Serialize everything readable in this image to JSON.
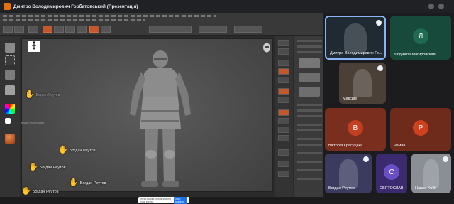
{
  "window": {
    "title": "Дмитро Володимирович Горбатовський (Презентація)"
  },
  "zbrush": {
    "raised_hands": [
      {
        "name": "Богдан Реутов"
      },
      {
        "name": "Богдан Реутов"
      },
      {
        "name": "Богдан Реутов"
      },
      {
        "name": "Богдан Реутов"
      }
    ],
    "ghost_name": "Богдан Реутов",
    "brush_tooltip": "Brush Placeholder",
    "share_bar": {
      "text": "meet.google.com is sharing your screen",
      "button": "Stop sharing"
    }
  },
  "participants": [
    {
      "name": "Дмитро Володимирович Го...",
      "type": "video",
      "color": "#1f2a33"
    },
    {
      "name": "Людмила Магировская",
      "type": "letter",
      "letter": "Л",
      "color": "#174a3a",
      "avatar": "#1e6b52"
    },
    {
      "name": "Максим",
      "type": "video",
      "color": "#4a4038"
    },
    {
      "name": "Вікторія Красуцька",
      "type": "letter",
      "letter": "В",
      "color": "#7a2e1e",
      "avatar": "#c43f22"
    },
    {
      "name": "Роман",
      "type": "letter",
      "letter": "Р",
      "color": "#6e2a1a",
      "avatar": "#d0421e"
    },
    {
      "name": "Богдан Реутов",
      "type": "video",
      "color": "#3a3b5e"
    },
    {
      "name": "СВЯТОСЛАВ",
      "type": "letter",
      "letter": "С",
      "color": "#3b2a6e",
      "avatar": "#6a4fc4"
    },
    {
      "name": "Hanna Kulik",
      "type": "video",
      "color": "#8a8f96"
    }
  ],
  "colors": {
    "accent": "#e8710a",
    "meet_blue": "#1a73e8"
  }
}
